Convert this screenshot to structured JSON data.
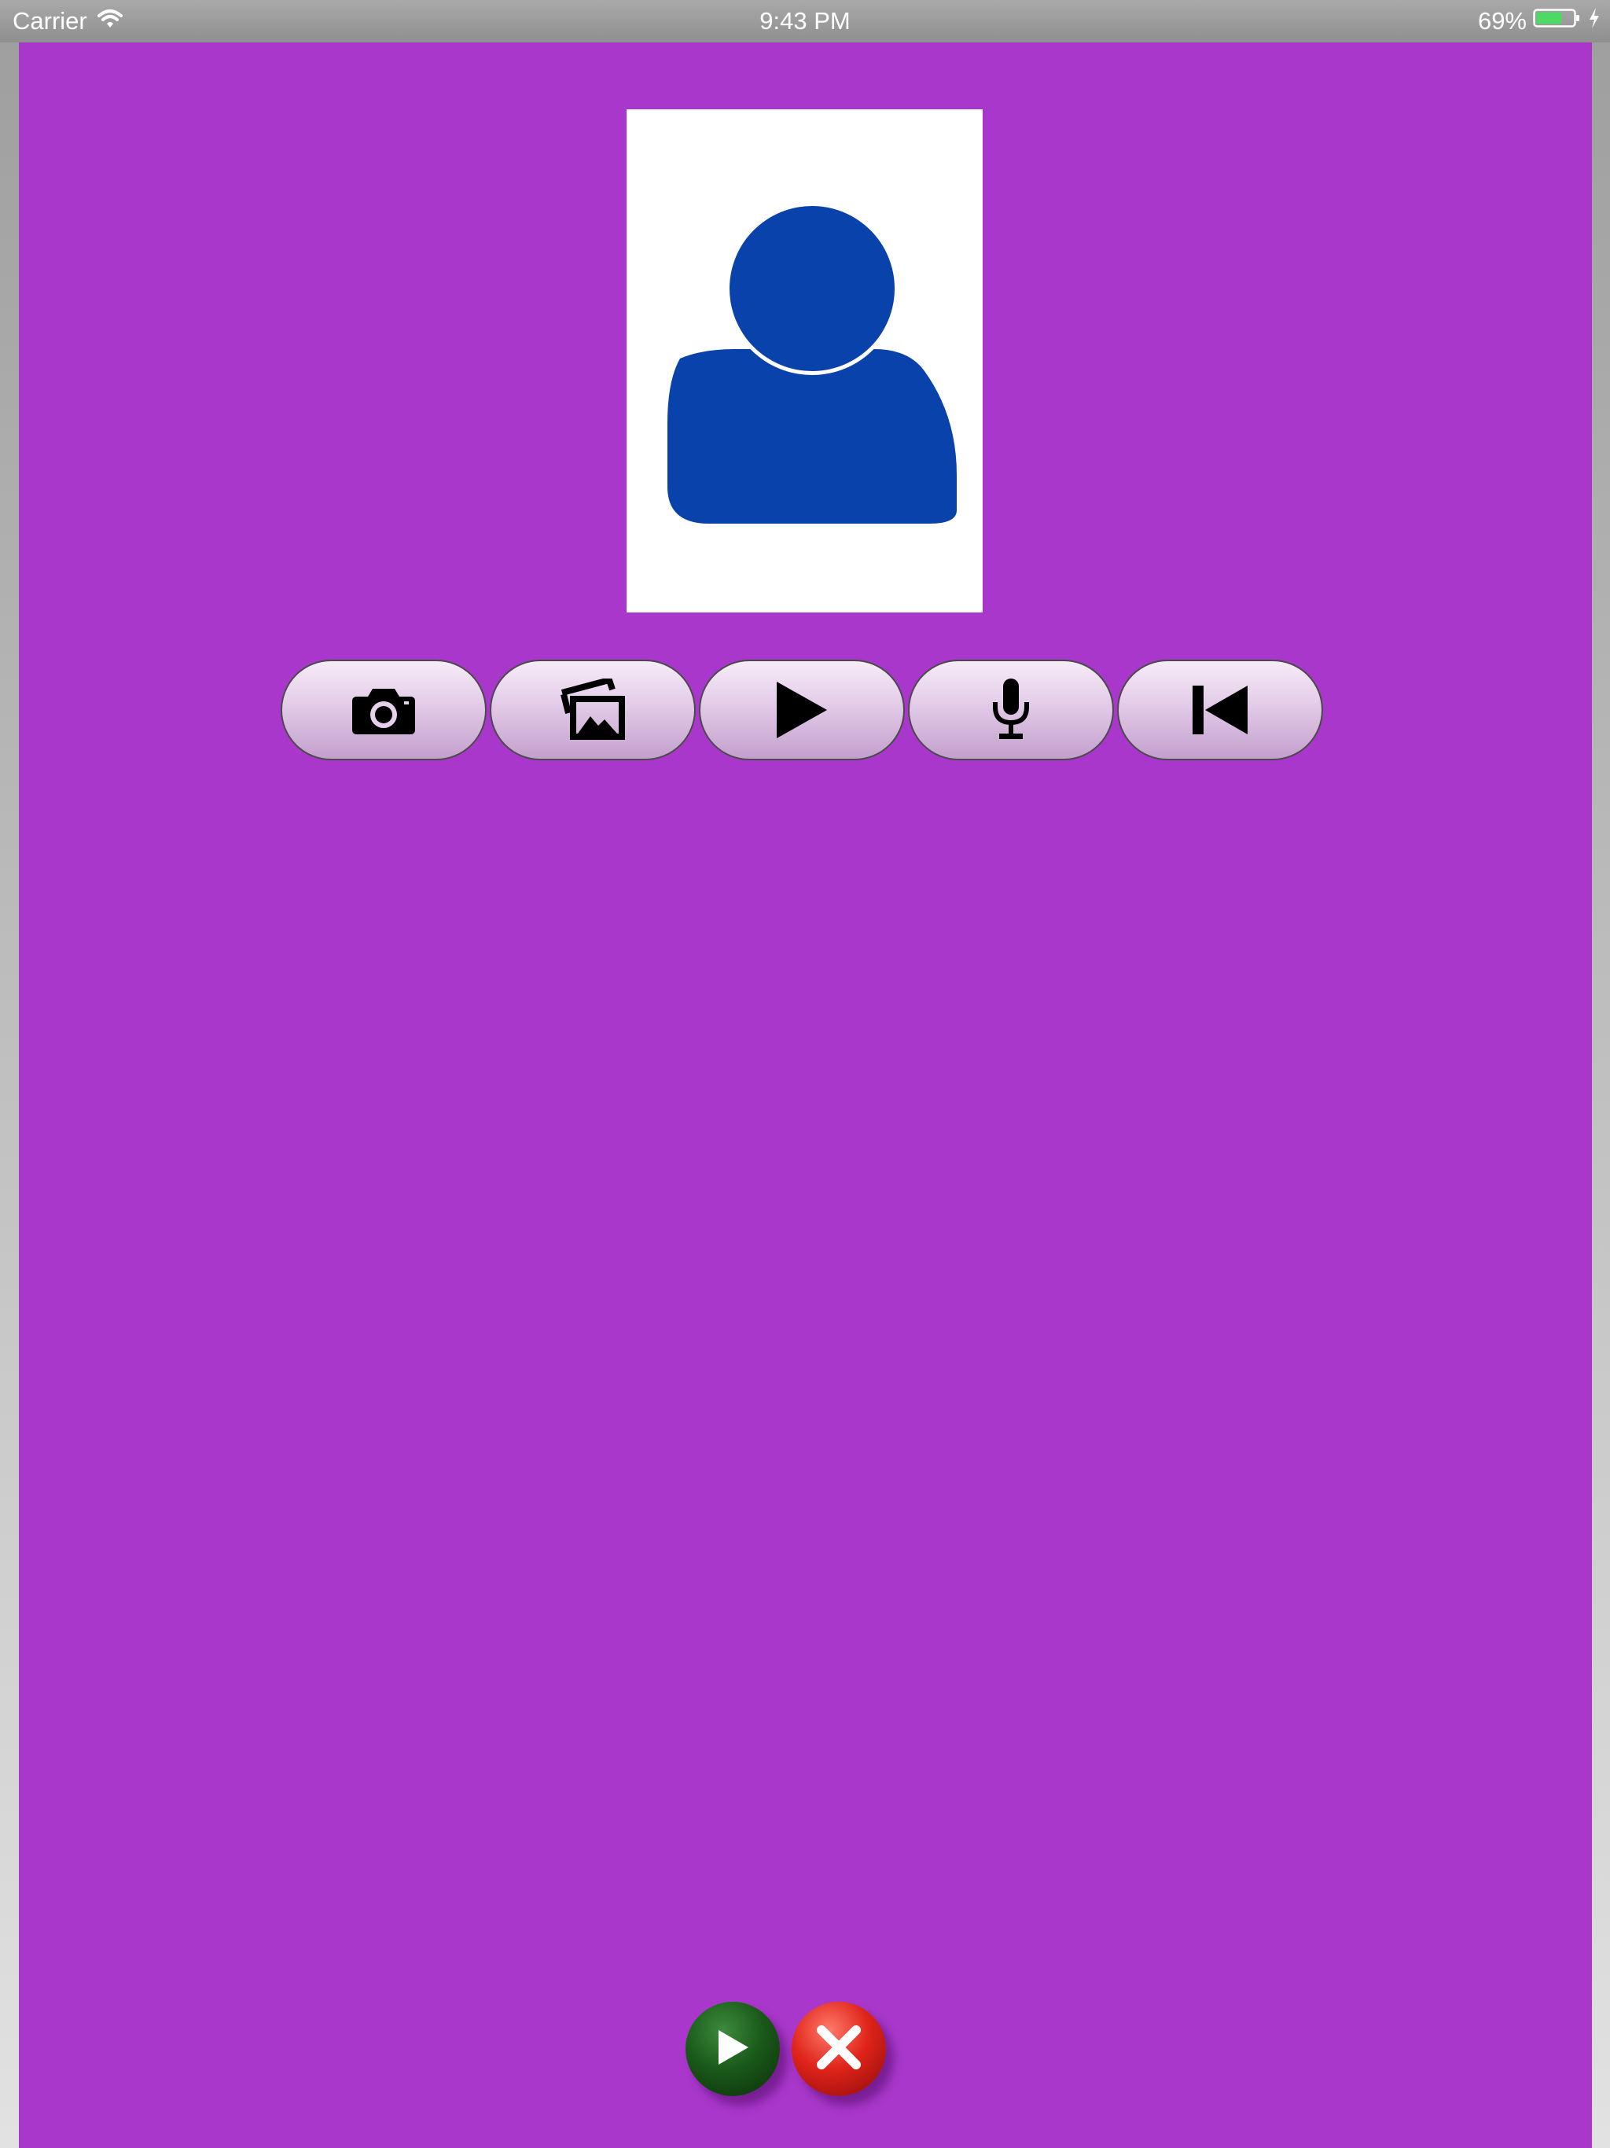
{
  "status_bar": {
    "carrier": "Carrier",
    "time": "9:43 PM",
    "battery_percent": "69%",
    "battery_level": 0.69,
    "battery_color": "#4cd964"
  },
  "colors": {
    "background": "#a937cb",
    "avatar_fill": "#0a42ac",
    "photo_frame": "#ffffff"
  },
  "profile": {
    "avatar_icon": "person-silhouette-icon"
  },
  "toolbar": {
    "buttons": [
      {
        "id": "camera",
        "icon": "camera-icon"
      },
      {
        "id": "gallery",
        "icon": "photo-gallery-icon"
      },
      {
        "id": "play",
        "icon": "play-icon"
      },
      {
        "id": "record",
        "icon": "microphone-icon"
      },
      {
        "id": "rewind",
        "icon": "skip-back-icon"
      }
    ]
  },
  "footer": {
    "go_icon": "play-icon",
    "cancel_icon": "close-icon"
  }
}
